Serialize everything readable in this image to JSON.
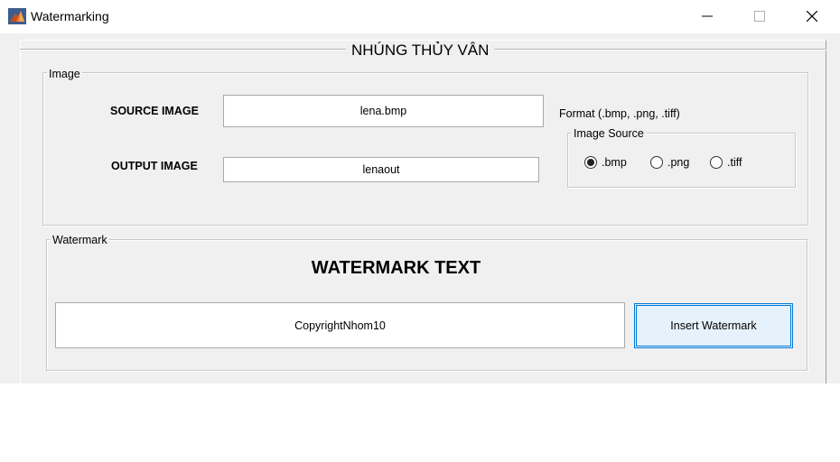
{
  "window": {
    "title": "Watermarking",
    "icon": "matlab-icon"
  },
  "panel": {
    "title": "NHÚNG THỦY VÂN"
  },
  "image_group": {
    "label": "Image",
    "source_label": "SOURCE IMAGE",
    "source_value": "lena.bmp",
    "output_label": "OUTPUT IMAGE",
    "output_value": "lenaout",
    "format_text": "Format (.bmp, .png, .tiff)",
    "image_source": {
      "label": "Image Source",
      "options": [
        {
          "label": ".bmp",
          "selected": true
        },
        {
          "label": ".png",
          "selected": false
        },
        {
          "label": ".tiff",
          "selected": false
        }
      ]
    }
  },
  "watermark_group": {
    "label": "Watermark",
    "heading": "WATERMARK TEXT",
    "text_value": "CopyrightNhom10",
    "insert_button": "Insert Watermark"
  },
  "colors": {
    "figure_background": "#f0f0f0",
    "button_focus_border": "#0078d7",
    "button_background": "#e5f1fb"
  }
}
